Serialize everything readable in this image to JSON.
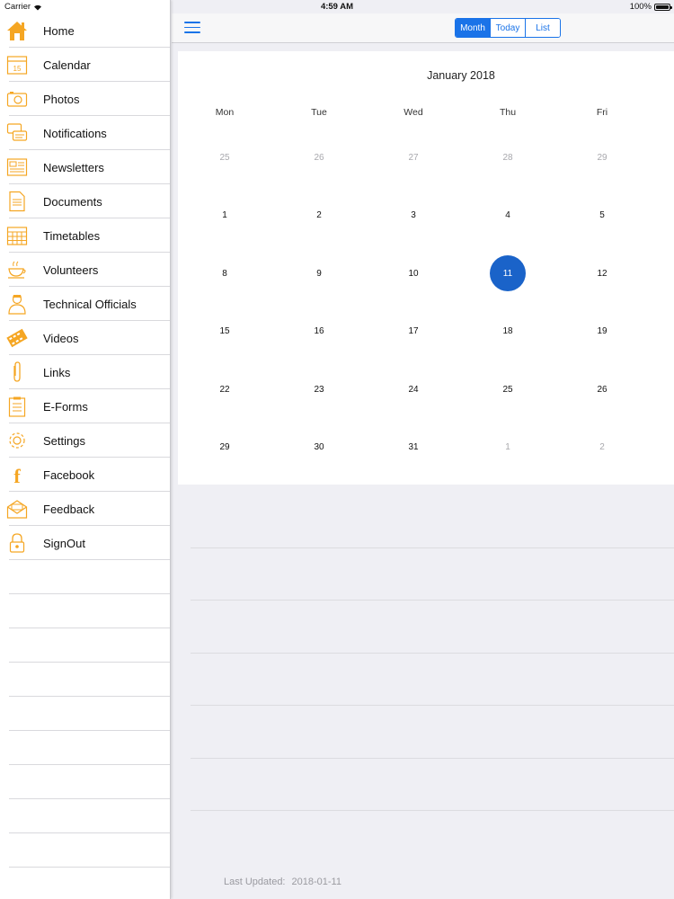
{
  "status_bar": {
    "carrier": "Carrier",
    "time": "4:59 AM",
    "battery": "100%",
    "battery_level": 1.0
  },
  "sidebar": {
    "items": [
      {
        "label": "Home",
        "icon": "home-icon"
      },
      {
        "label": "Calendar",
        "icon": "calendar-icon"
      },
      {
        "label": "Photos",
        "icon": "camera-icon"
      },
      {
        "label": "Notifications",
        "icon": "chat-bubbles-icon"
      },
      {
        "label": "Newsletters",
        "icon": "newspaper-icon"
      },
      {
        "label": "Documents",
        "icon": "document-icon"
      },
      {
        "label": "Timetables",
        "icon": "timetable-icon"
      },
      {
        "label": "Volunteers",
        "icon": "teacup-icon"
      },
      {
        "label": "Technical Officials",
        "icon": "official-person-icon"
      },
      {
        "label": "Videos",
        "icon": "film-strip-icon"
      },
      {
        "label": "Links",
        "icon": "paperclip-icon"
      },
      {
        "label": "E-Forms",
        "icon": "clipboard-form-icon"
      },
      {
        "label": "Settings",
        "icon": "gear-icon"
      },
      {
        "label": "Facebook",
        "icon": "facebook-icon"
      },
      {
        "label": "Feedback",
        "icon": "feedback-envelope-icon"
      },
      {
        "label": "SignOut",
        "icon": "padlock-icon"
      }
    ]
  },
  "toolbar": {
    "menu_icon": "hamburger-icon",
    "view_modes": [
      "Month",
      "Today",
      "List"
    ],
    "active_mode": "Month"
  },
  "calendar": {
    "title": "January 2018",
    "weekdays": [
      "Mon",
      "Tue",
      "Wed",
      "Thu",
      "Fri"
    ],
    "weeks": [
      [
        {
          "d": "25",
          "muted": true
        },
        {
          "d": "26",
          "muted": true
        },
        {
          "d": "27",
          "muted": true
        },
        {
          "d": "28",
          "muted": true
        },
        {
          "d": "29",
          "muted": true
        }
      ],
      [
        {
          "d": "1"
        },
        {
          "d": "2"
        },
        {
          "d": "3"
        },
        {
          "d": "4"
        },
        {
          "d": "5"
        }
      ],
      [
        {
          "d": "8"
        },
        {
          "d": "9"
        },
        {
          "d": "10"
        },
        {
          "d": "11",
          "selected": true
        },
        {
          "d": "12"
        }
      ],
      [
        {
          "d": "15"
        },
        {
          "d": "16"
        },
        {
          "d": "17"
        },
        {
          "d": "18"
        },
        {
          "d": "19"
        }
      ],
      [
        {
          "d": "22"
        },
        {
          "d": "23"
        },
        {
          "d": "24"
        },
        {
          "d": "25"
        },
        {
          "d": "26"
        }
      ],
      [
        {
          "d": "29"
        },
        {
          "d": "30"
        },
        {
          "d": "31"
        },
        {
          "d": "1",
          "muted": true
        },
        {
          "d": "2",
          "muted": true
        }
      ]
    ]
  },
  "footer": {
    "last_updated_label": "Last Updated:",
    "last_updated_value": "2018-01-11"
  },
  "colors": {
    "accent": "#1a73e8",
    "selected_day": "#1a63c9",
    "icon_orange": "#f5a623"
  }
}
